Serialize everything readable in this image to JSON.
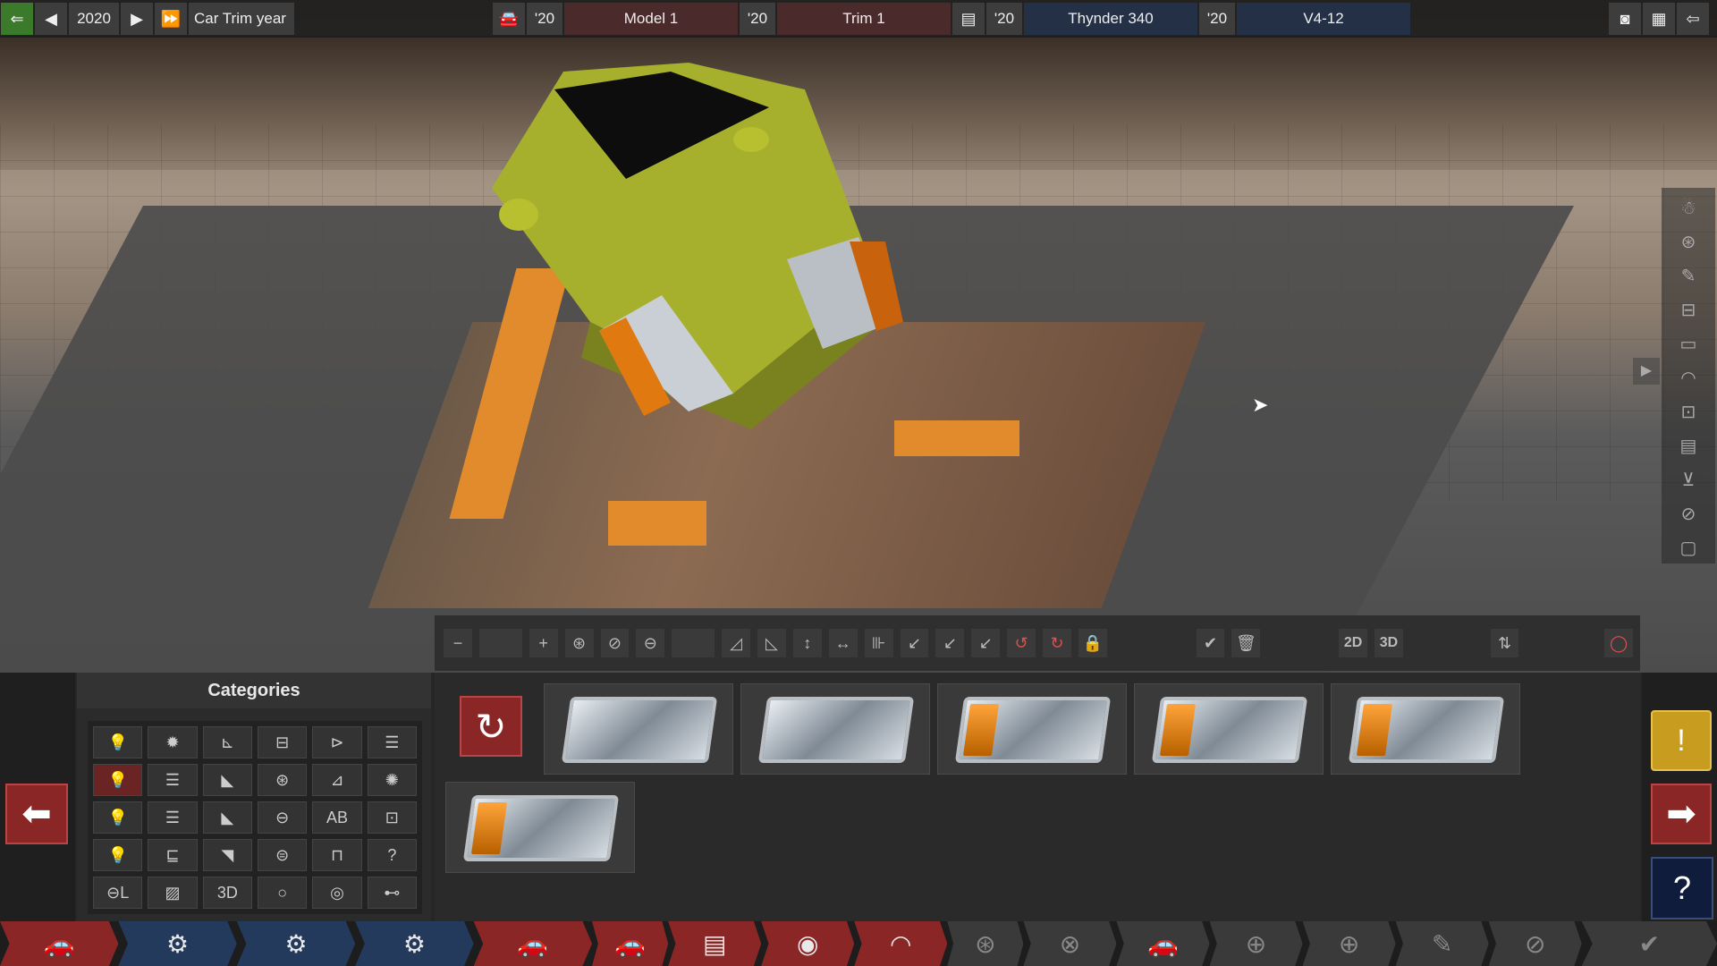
{
  "topbar": {
    "year": "2020",
    "trim_year_label": "Car Trim year",
    "model_year": "'20",
    "model": "Model 1",
    "trim_year": "'20",
    "trim": "Trim 1",
    "engine_year": "'20",
    "engine": "Thynder 340",
    "variant_year": "'20",
    "variant": "V4-12"
  },
  "categories": {
    "title": "Categories",
    "grid": [
      "💡",
      "✹",
      "⊾",
      "⊟",
      "⊳",
      "☰",
      "💡",
      "☰",
      "◣",
      "⊛",
      "⊿",
      "✺",
      "💡",
      "☰",
      "◣",
      "⊖",
      "AB",
      "⊡",
      "💡",
      "⊑",
      "◥",
      "⊜",
      "⊓",
      "?",
      "⊖L",
      "▨",
      "3D",
      "○",
      "◎",
      "⊷"
    ]
  },
  "toolbar": {
    "buttons": [
      "−",
      "+",
      "⊛",
      "⊘",
      "⊖",
      "◿",
      "◺",
      "↕",
      "↔",
      "⊪",
      "↙",
      "↙",
      "↙",
      "↺",
      "↻",
      "🔒"
    ],
    "view_2d": "2D",
    "view_3d": "3D",
    "confirm": "✔",
    "delete": "🗑"
  },
  "parts": {
    "count": 6,
    "variants": [
      "clear",
      "clear",
      "orange",
      "orange",
      "orange",
      "orange"
    ]
  },
  "bottom_nav": {
    "tabs": [
      "🚗",
      "⚙",
      "⚙",
      "⚙",
      "🚗",
      "🚗",
      "▤",
      "◉",
      "◠",
      "⊛",
      "⊗",
      "🚗",
      "⊕",
      "⊕",
      "✎",
      "⊘",
      "✔"
    ]
  },
  "colors": {
    "accent_red": "#8b2626",
    "accent_blue": "#233a5c",
    "warning_yellow": "#c89c1e",
    "car_body": "#a6b02c"
  }
}
